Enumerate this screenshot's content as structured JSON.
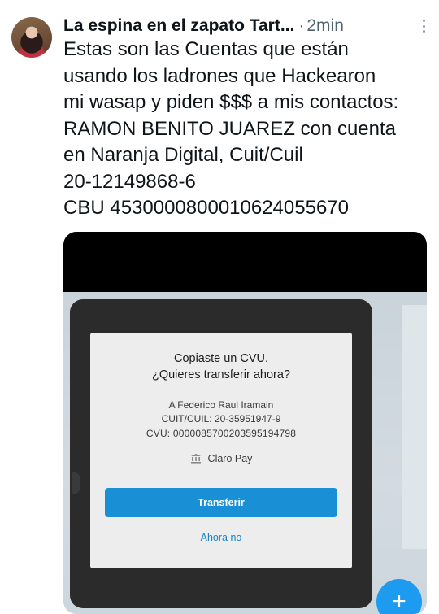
{
  "post": {
    "author": "La espina en el zapato Tart...",
    "separator": "·",
    "time": "2min",
    "text": "Estas son las Cuentas que están\nusando  los ladrones que Hackearon\nmi wasap y piden $$$ a mis contactos:\nRAMON BENITO JUAREZ con cuenta\nen Naranja Digital, Cuit/Cuil\n20-12149868-6\nCBU 4530000800010624055670"
  },
  "dialog": {
    "title": "Copiaste un CVU.",
    "subtitle": "¿Quieres transferir ahora?",
    "recipient": "A Federico Raul Iramain",
    "cuit": "CUIT/CUIL: 20-35951947-9",
    "cvu": "CVU: 0000085700203595194798",
    "provider": "Claro Pay",
    "primary_button": "Transferir",
    "secondary_button": "Ahora no"
  },
  "icons": {
    "more": "more-vertical-icon",
    "bank": "bank-icon",
    "fab": "plus-icon"
  },
  "colors": {
    "accent_button": "#1990d5",
    "link": "#1583c4",
    "fab": "#1d9bf0"
  }
}
